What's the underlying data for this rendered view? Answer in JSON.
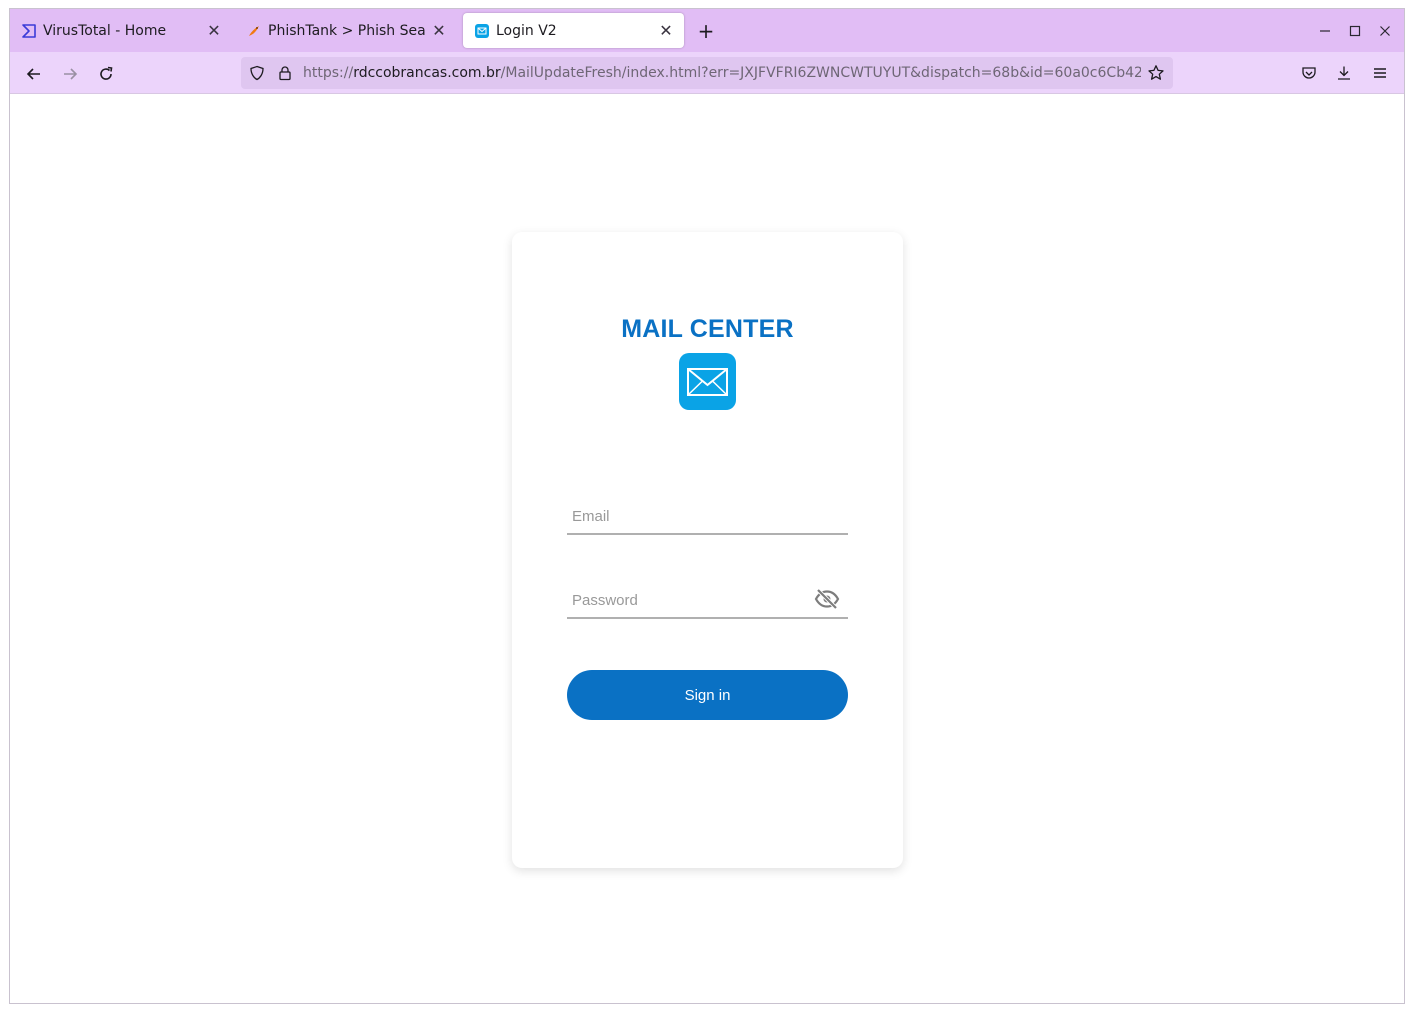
{
  "browser": {
    "tabs": [
      {
        "title": "VirusTotal - Home",
        "icon": "virustotal-icon",
        "active": false
      },
      {
        "title": "PhishTank > Phish Search",
        "icon": "phishtank-icon",
        "active": false
      },
      {
        "title": "Login V2",
        "icon": "mail-favicon",
        "active": true
      }
    ],
    "new_tab_label": "+",
    "url": {
      "scheme": "https://",
      "host": "rdccobrancas.com.br",
      "path": "/MailUpdateFresh/index.html?err=JXJFVFRI6ZWNCWTUYUT&dispatch=68b&id=60a0c6Cb42"
    }
  },
  "page": {
    "brand": "MAIL CENTER",
    "email_placeholder": "Email",
    "password_placeholder": "Password",
    "signin_label": "Sign in",
    "colors": {
      "accent": "#0a71c4",
      "icon_bg": "#0aa3e6"
    }
  }
}
